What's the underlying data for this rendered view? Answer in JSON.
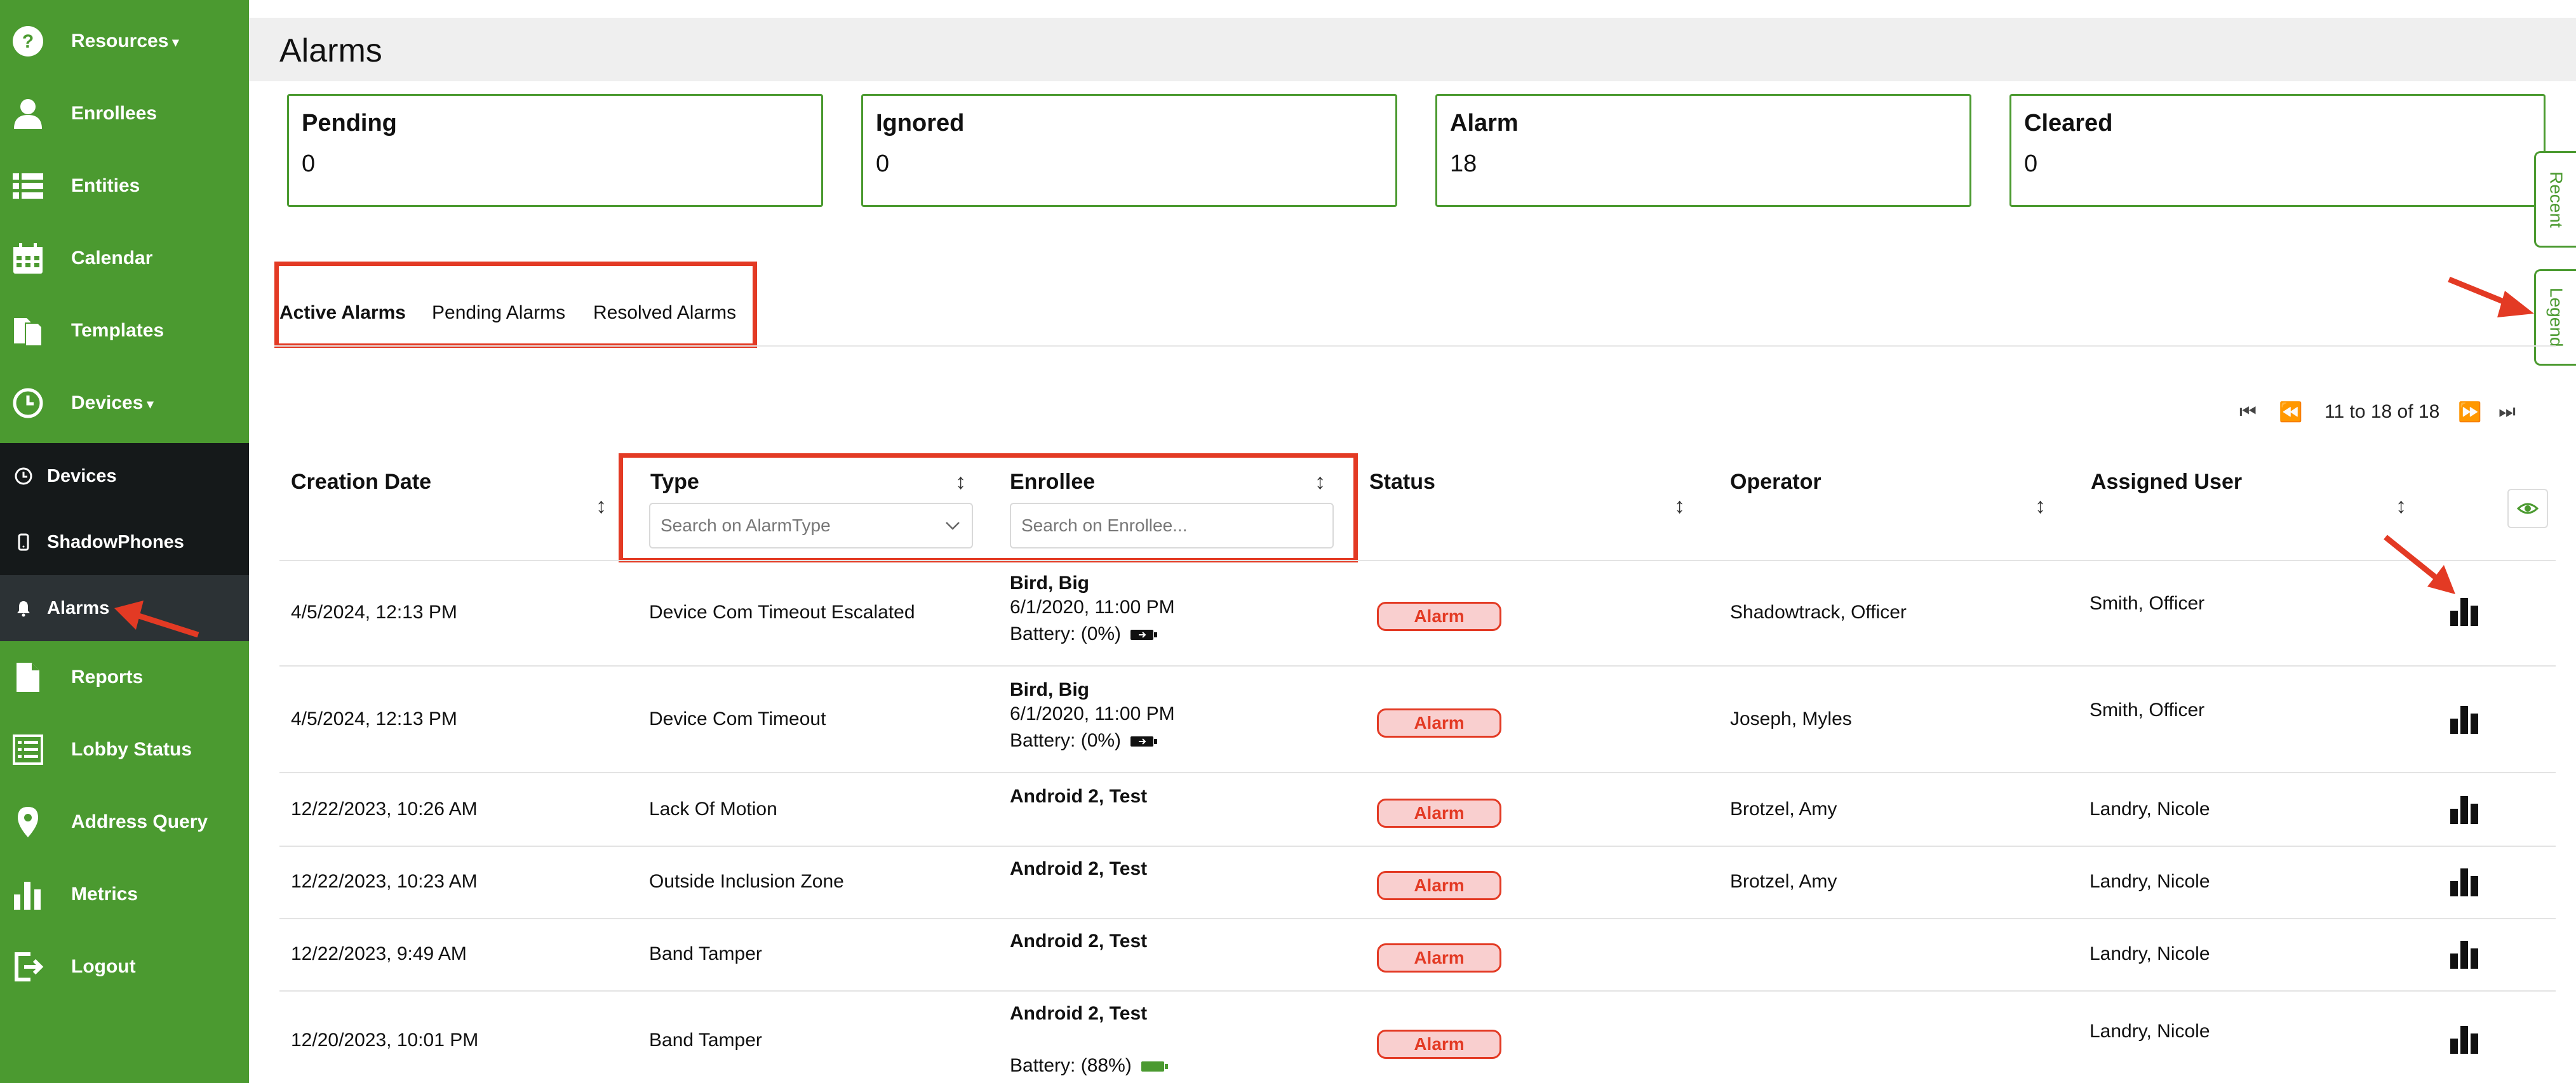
{
  "sidebar": {
    "items": [
      {
        "label": "Resources",
        "icon": "help-circle-icon",
        "caret": "▾"
      },
      {
        "label": "Enrollees",
        "icon": "person-icon"
      },
      {
        "label": "Entities",
        "icon": "list-icon"
      },
      {
        "label": "Calendar",
        "icon": "calendar-icon"
      },
      {
        "label": "Templates",
        "icon": "templates-icon"
      },
      {
        "label": "Devices",
        "icon": "clock-icon",
        "caret": "▾"
      },
      {
        "label": "Devices",
        "icon": "clock-small-icon"
      },
      {
        "label": "ShadowPhones",
        "icon": "phone-icon"
      },
      {
        "label": "Alarms",
        "icon": "bell-icon"
      },
      {
        "label": "Reports",
        "icon": "document-icon"
      },
      {
        "label": "Lobby Status",
        "icon": "checklist-icon"
      },
      {
        "label": "Address Query",
        "icon": "map-pin-icon"
      },
      {
        "label": "Metrics",
        "icon": "bar-chart-icon"
      },
      {
        "label": "Logout",
        "icon": "logout-icon"
      }
    ]
  },
  "page": {
    "title": "Alarms"
  },
  "stats": [
    {
      "label": "Pending",
      "value": "0"
    },
    {
      "label": "Ignored",
      "value": "0"
    },
    {
      "label": "Alarm",
      "value": "18"
    },
    {
      "label": "Cleared",
      "value": "0"
    }
  ],
  "side_tabs": {
    "recent": "Recent",
    "legend": "Legend"
  },
  "tabs": [
    "Active Alarms",
    "Pending Alarms",
    "Resolved Alarms"
  ],
  "pager": {
    "range": "11 to 18 of 18",
    "first": "⏮",
    "prev": "⏪",
    "next": "⏩",
    "last": "⏭"
  },
  "table": {
    "columns": [
      "Creation Date",
      "Type",
      "Enrollee",
      "Status",
      "Operator",
      "Assigned User"
    ],
    "filters": {
      "type_placeholder": "Search on AlarmType",
      "enrollee_placeholder": "Search on Enrollee..."
    },
    "rows": [
      {
        "date": "4/5/2024, 12:13 PM",
        "type": "Device Com Timeout Escalated",
        "enrollee": "Bird, Big",
        "enrollee_date": "6/1/2020, 11:00 PM",
        "battery": "Battery: (0%)",
        "status": "Alarm",
        "operator": "Shadowtrack, Officer",
        "assigned": "Smith, Officer"
      },
      {
        "date": "4/5/2024, 12:13 PM",
        "type": "Device Com Timeout",
        "enrollee": "Bird, Big",
        "enrollee_date": "6/1/2020, 11:00 PM",
        "battery": "Battery: (0%)",
        "status": "Alarm",
        "operator": "Joseph, Myles",
        "assigned": "Smith, Officer"
      },
      {
        "date": "12/22/2023, 10:26 AM",
        "type": "Lack Of Motion",
        "enrollee": "Android 2, Test",
        "status": "Alarm",
        "operator": "Brotzel, Amy",
        "assigned": "Landry, Nicole"
      },
      {
        "date": "12/22/2023, 10:23 AM",
        "type": "Outside Inclusion Zone",
        "enrollee": "Android 2, Test",
        "status": "Alarm",
        "operator": "Brotzel, Amy",
        "assigned": "Landry, Nicole"
      },
      {
        "date": "12/22/2023, 9:49 AM",
        "type": "Band Tamper",
        "enrollee": "Android 2, Test",
        "status": "Alarm",
        "operator": "",
        "assigned": "Landry, Nicole"
      },
      {
        "date": "12/20/2023, 10:01 PM",
        "type": "Band Tamper",
        "enrollee": "Android 2, Test",
        "battery": "Battery: (88%)",
        "status": "Alarm",
        "operator": "",
        "assigned": "Landry, Nicole"
      }
    ]
  },
  "colors": {
    "brand_green": "#4b9a30",
    "annotation_red": "#e33a24",
    "badge_fill": "#f9cfcf",
    "sidebar_dark": "#15191a"
  }
}
